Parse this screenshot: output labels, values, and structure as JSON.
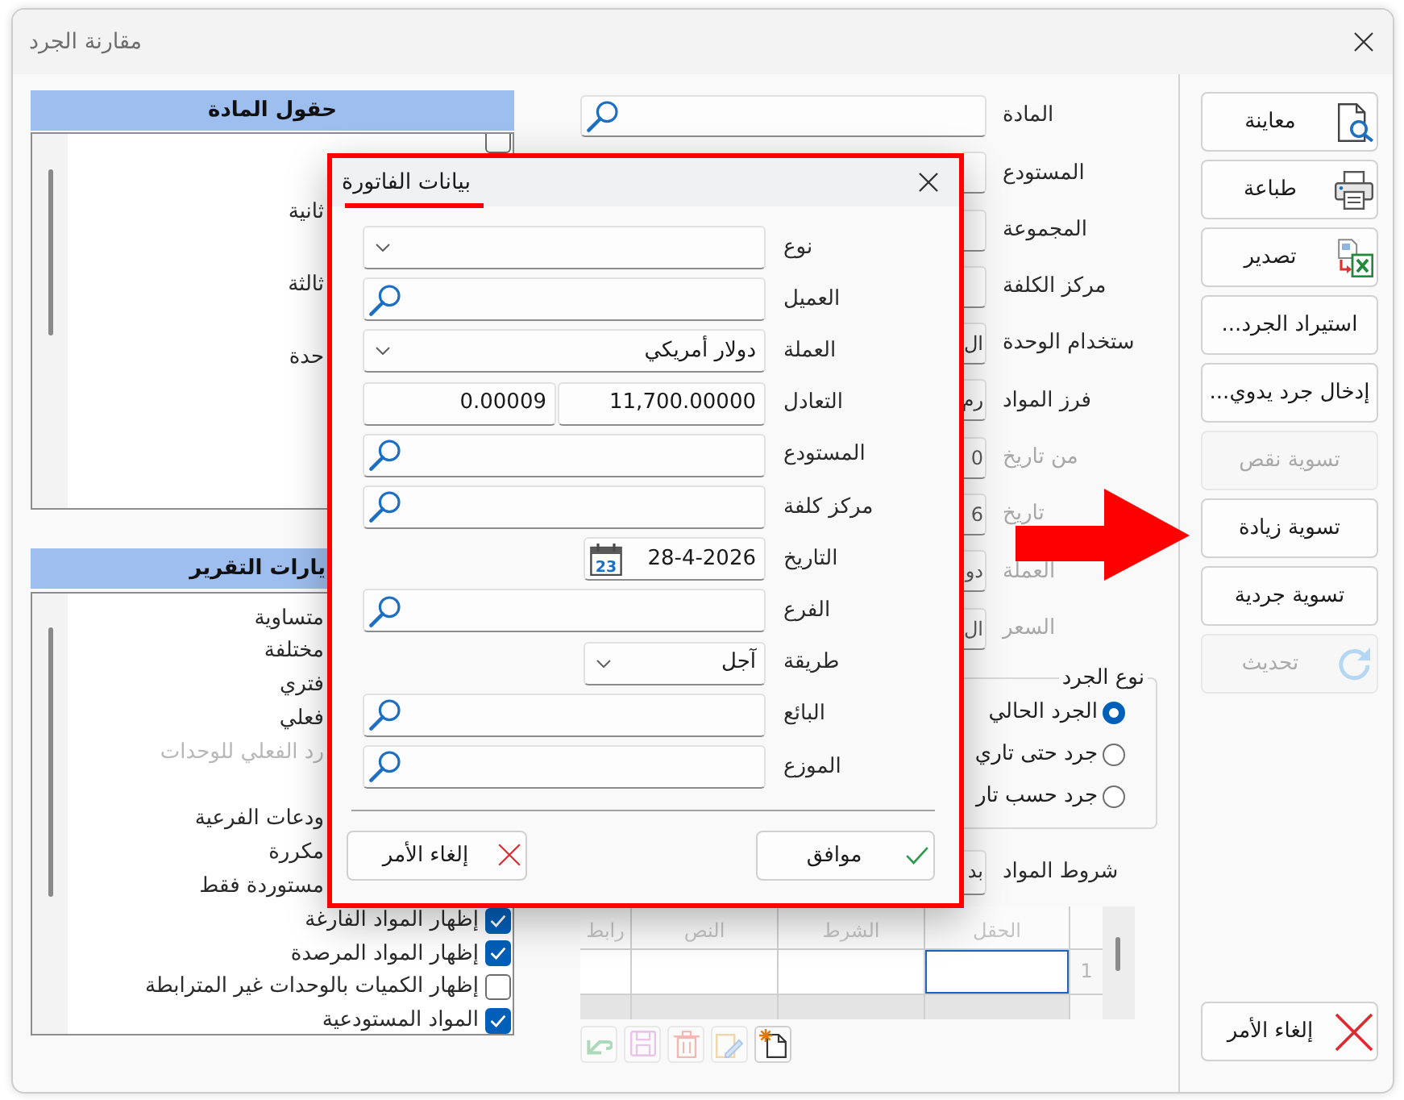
{
  "window": {
    "title": "مقارنة الجرد"
  },
  "panels": [
    {
      "title": "حقول المادة",
      "items": [
        {
          "kind": "checkbox",
          "checked": false
        },
        {
          "kind": "text",
          "label": "ثانية"
        },
        {
          "kind": "text",
          "label": "ثالثة"
        },
        {
          "kind": "text",
          "label": "حدة"
        }
      ]
    },
    {
      "title": "يارات التقرير",
      "items": [
        {
          "kind": "text",
          "label": "متساوية",
          "disabled": false
        },
        {
          "kind": "text",
          "label": "مختلفة",
          "disabled": false
        },
        {
          "kind": "text",
          "label": "فتري",
          "disabled": false
        },
        {
          "kind": "text",
          "label": "فعلي",
          "disabled": false
        },
        {
          "kind": "text",
          "label": "رد الفعلي للوحدات",
          "disabled": true
        },
        {
          "kind": "text",
          "label": "ودعات الفرعية",
          "disabled": false
        },
        {
          "kind": "text",
          "label": "مكررة",
          "disabled": false
        },
        {
          "kind": "text",
          "label": "مستوردة فقط",
          "disabled": false
        },
        {
          "kind": "checkbox",
          "label": "إظهار المواد الفارغة",
          "checked": true,
          "disabled": false
        },
        {
          "kind": "checkbox",
          "label": "إظهار المواد المرصدة",
          "checked": true,
          "disabled": false
        },
        {
          "kind": "checkbox",
          "label": "إظهار الكميات بالوحدات غير المترابطة",
          "checked": false,
          "disabled": false
        },
        {
          "kind": "checkbox",
          "label": "المواد المستودعية",
          "checked": true,
          "disabled": false
        }
      ]
    }
  ],
  "form": {
    "rows": [
      {
        "label": "المادة",
        "kind": "search",
        "disabled": false
      },
      {
        "label": "المستودع",
        "kind": "clipped",
        "disabled": false
      },
      {
        "label": "المجموعة",
        "kind": "clipped",
        "disabled": false
      },
      {
        "label": "مركز الكلفة",
        "kind": "clipped",
        "disabled": false
      },
      {
        "label": "ستخدام الوحدة",
        "kind": "clipped",
        "value": "ال",
        "disabled": false
      },
      {
        "label": "فرز المواد",
        "kind": "clipped",
        "value": "رم",
        "disabled": false
      },
      {
        "label": "من تاريخ",
        "kind": "clipped",
        "value": "0",
        "disabled": true
      },
      {
        "label": "تاريخ",
        "kind": "clipped",
        "value": "6",
        "disabled": true
      },
      {
        "label": "العملة",
        "kind": "clipped",
        "value": "دو",
        "disabled": true
      },
      {
        "label": "السعر",
        "kind": "clipped",
        "value": "ال",
        "disabled": true
      }
    ]
  },
  "stock_type": {
    "title": "نوع الجرد",
    "options": [
      {
        "label": "الجرد الحالي",
        "selected": true
      },
      {
        "label": "جرد حتى تاري",
        "selected": false
      },
      {
        "label": "جرد حسب تار",
        "selected": false
      }
    ]
  },
  "item_conditions": {
    "label": "شروط المواد",
    "value": "بد"
  },
  "conditions_grid": {
    "columns": [
      "الحقل",
      "الشرط",
      "النص",
      "رابط"
    ],
    "rows": [
      {
        "number": "1",
        "cells": [
          {
            "selected": true
          },
          {
            "selected": false
          },
          {
            "selected": false
          },
          {
            "selected": false
          }
        ]
      },
      {
        "cells": [
          {
            "selected": false
          },
          {
            "selected": false
          },
          {
            "selected": false
          },
          {
            "selected": false
          }
        ]
      }
    ]
  },
  "grid_toolbar": [
    {
      "kind": "new",
      "disabled": false
    },
    {
      "kind": "edit",
      "disabled": true
    },
    {
      "kind": "delete",
      "disabled": true
    },
    {
      "kind": "save",
      "disabled": true
    },
    {
      "kind": "undo",
      "disabled": true
    }
  ],
  "actions": [
    {
      "kind": "preview",
      "label": "معاينة",
      "disabled": false
    },
    {
      "kind": "print",
      "label": "طباعة",
      "disabled": false
    },
    {
      "kind": "export",
      "label": "تصدير",
      "disabled": false
    },
    {
      "kind": "plain",
      "label": "استيراد الجرد...",
      "disabled": false
    },
    {
      "kind": "plain",
      "label": "إدخال جرد يدوي...",
      "disabled": false
    },
    {
      "kind": "plain",
      "label": "تسوية نقص",
      "disabled": true
    },
    {
      "kind": "plain",
      "label": "تسوية زيادة",
      "disabled": false
    },
    {
      "kind": "plain",
      "label": "تسوية جردية",
      "disabled": false
    },
    {
      "kind": "refresh",
      "label": "تحديث",
      "disabled": true
    },
    {
      "kind": "cancel",
      "label": "إلغاء الأمر",
      "disabled": false
    }
  ],
  "invoice_dialog": {
    "title": "بيانات الفاتورة",
    "rows": [
      {
        "label": "نوع",
        "kind": "select"
      },
      {
        "label": "العميل",
        "kind": "search"
      },
      {
        "label": "العملة",
        "kind": "select",
        "value": "دولار أمريكي"
      },
      {
        "label": "التعادل",
        "kind": "amounts",
        "values": [
          "11,700.00000",
          "0.00009"
        ]
      },
      {
        "label": "المستودع",
        "kind": "search"
      },
      {
        "label": "مركز كلفة",
        "kind": "search"
      },
      {
        "label": "التاريخ",
        "kind": "date",
        "value": "28-4-2026",
        "calendar_day": "23"
      },
      {
        "label": "الفرع",
        "kind": "search"
      },
      {
        "label": "طريقة",
        "kind": "choice",
        "value": "آجل"
      },
      {
        "label": "البائع",
        "kind": "search"
      },
      {
        "label": "الموزع",
        "kind": "search"
      }
    ],
    "buttons": [
      {
        "kind": "ok",
        "label": "موافق"
      },
      {
        "kind": "cancel",
        "label": "إلغاء الأمر"
      }
    ]
  },
  "annotations": [
    {
      "kind": "frame"
    },
    {
      "kind": "underline"
    },
    {
      "kind": "arrow"
    }
  ]
}
